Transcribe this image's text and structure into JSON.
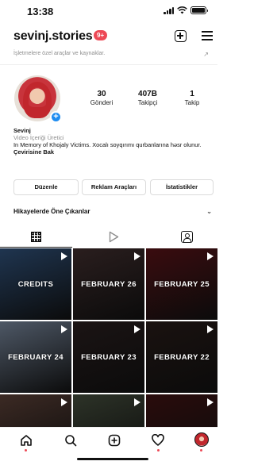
{
  "status_bar": {
    "time": "13:38"
  },
  "header": {
    "username": "sevinj.stories",
    "notification_count": "9+"
  },
  "business_line": "İşletmelere özel araçlar ve kaynaklar.",
  "profile": {
    "posts_count": "30",
    "posts_label": "Gönderi",
    "followers_count": "407B",
    "followers_label": "Takipçi",
    "following_count": "1",
    "following_label": "Takip"
  },
  "bio": {
    "name": "Sevinj",
    "category": "Video İçeriği Üretici",
    "text": "In Memory of Khojaly Victims. Xocalı soyqırımı qurbanlarına həsr olunur.",
    "see_translation": "Çevirisine Bak"
  },
  "buttons": {
    "edit": "Düzenle",
    "ad_tools": "Reklam Araçları",
    "insights": "İstatistikler"
  },
  "highlights_label": "Hikayelerde Öne Çıkanlar",
  "grid": [
    {
      "label": "CREDITS",
      "color": "#1f3550"
    },
    {
      "label": "FEBRUARY 26",
      "color": "#2a1e1e"
    },
    {
      "label": "FEBRUARY 25",
      "color": "#3a0c0f"
    },
    {
      "label": "FEBRUARY 24",
      "color": "#4e5866"
    },
    {
      "label": "FEBRUARY 23",
      "color": "#1b1414"
    },
    {
      "label": "FEBRUARY 22",
      "color": "#1a1210"
    },
    {
      "label": "",
      "color": "#3c2a24"
    },
    {
      "label": "",
      "color": "#2d3328"
    },
    {
      "label": "",
      "color": "#2a0c0c"
    }
  ],
  "colors": {
    "accent": "#ed4956",
    "link_blue": "#1d8cf0",
    "muted": "#8e8e8e"
  },
  "icons": {
    "header": [
      "add-post-icon",
      "menu-icon"
    ],
    "tabs": [
      "grid-icon",
      "reels-tab-icon",
      "tagged-icon"
    ],
    "bottom_nav": [
      "home-icon",
      "search-icon",
      "new-post-icon",
      "activity-icon",
      "profile-avatar-icon"
    ]
  }
}
